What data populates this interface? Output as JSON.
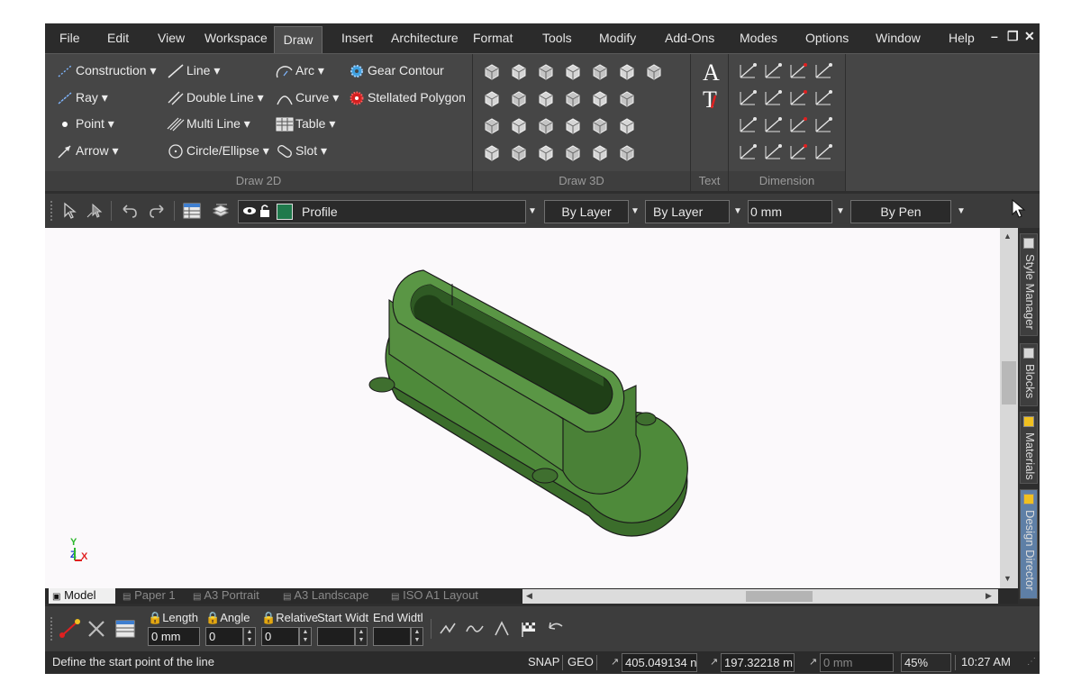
{
  "menu": {
    "items": [
      "File",
      "Edit",
      "View",
      "Workspace",
      "Draw",
      "Insert",
      "Architecture",
      "Format",
      "Tools",
      "Modify",
      "Add-Ons",
      "Modes",
      "Options",
      "Window",
      "Help"
    ],
    "active": "Draw"
  },
  "ribbon": {
    "draw2d": {
      "label": "Draw 2D",
      "col1": [
        "Construction",
        "Ray",
        "Point",
        "Arrow"
      ],
      "col2": [
        "Line",
        "Double Line",
        "Multi Line",
        "Circle/Ellipse"
      ],
      "col3": [
        "Arc",
        "Curve",
        "Table",
        "Slot"
      ],
      "col4": [
        "Gear Contour",
        "Stellated Polygon"
      ]
    },
    "draw3d": {
      "label": "Draw 3D"
    },
    "text": {
      "label": "Text"
    },
    "dimension": {
      "label": "Dimension"
    }
  },
  "toolbar": {
    "profile": "Profile",
    "line_color": "By Layer",
    "line_style": "By Layer",
    "line_width": "0 mm",
    "pen": "By Pen",
    "profile_color": "#1f7a4c"
  },
  "side_panels": [
    "Style Manager",
    "Blocks",
    "Materials",
    "Design Director"
  ],
  "layout_tabs": [
    "Model",
    "Paper 1",
    "A3 Portrait",
    "A3 Landscape",
    "ISO A1 Layout"
  ],
  "inputbar": {
    "length_label": "Length",
    "length_value": "0 mm",
    "angle_label": "Angle",
    "angle_value": "0",
    "relative_label": "Relative",
    "relative_value": "0",
    "start_width_label": "Start Widt",
    "end_width_label": "End Widtl"
  },
  "status": {
    "message": "Define the start point of the line",
    "snap": "SNAP",
    "geo": "GEO",
    "x_value": "405.049134 n",
    "y_value": "197.32218 m",
    "z_value": "0 mm",
    "zoom": "45%",
    "time": "10:27 AM"
  },
  "axes": {
    "x": "X",
    "y": "Y",
    "z": "Z"
  },
  "colors": {
    "model": "#4e8a3a",
    "model_dark": "#3b6d2b",
    "accent": "#3fa0e0"
  }
}
